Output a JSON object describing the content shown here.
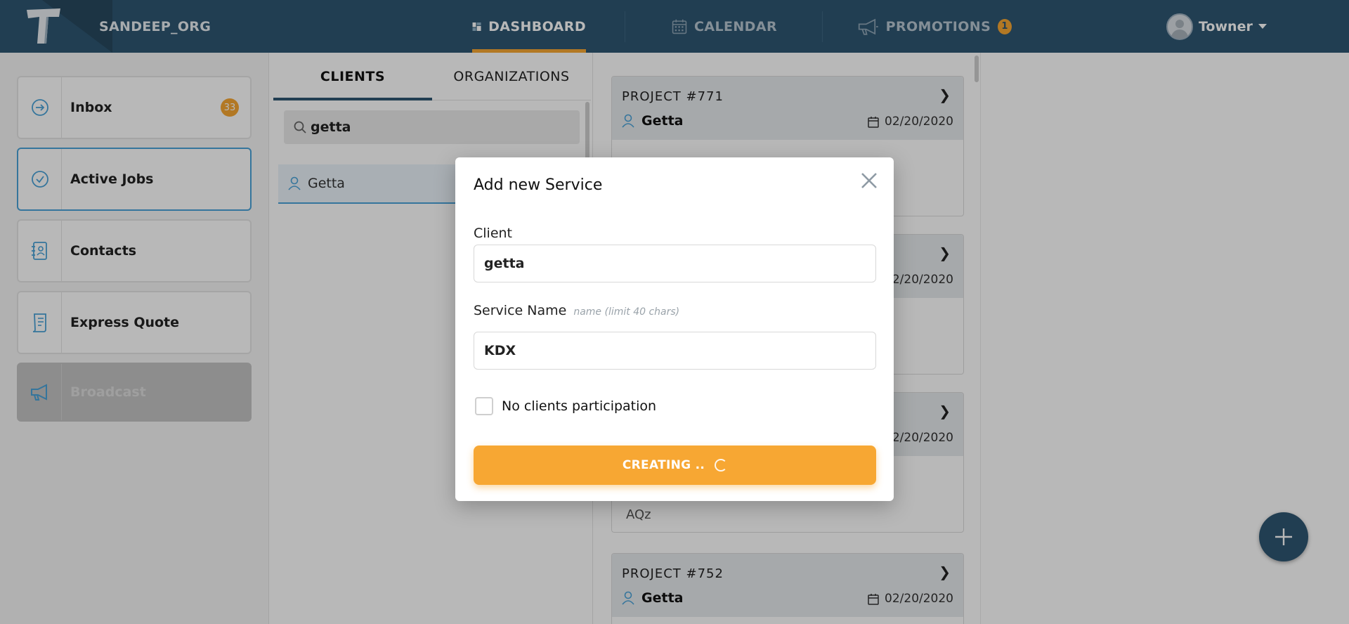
{
  "org": {
    "name": "SANDEEP_ORG"
  },
  "nav": {
    "dashboard": "DASHBOARD",
    "calendar": "CALENDAR",
    "promotions": "PROMOTIONS",
    "promotions_badge": "1"
  },
  "user": {
    "name": "Towner"
  },
  "sidebar": {
    "items": [
      {
        "label": "Inbox",
        "icon": "arrow-circle-icon",
        "badge": "33"
      },
      {
        "label": "Active Jobs",
        "icon": "check-circle-icon"
      },
      {
        "label": "Contacts",
        "icon": "contacts-book-icon"
      },
      {
        "label": "Express Quote",
        "icon": "quote-doc-icon"
      },
      {
        "label": "Broadcast",
        "icon": "megaphone-icon"
      }
    ]
  },
  "clients": {
    "tabs": [
      "CLIENTS",
      "ORGANIZATIONS"
    ],
    "search_value": "getta",
    "list": [
      {
        "name": "Getta"
      }
    ]
  },
  "projects": [
    {
      "title": "PROJECT #771",
      "client": "Getta",
      "date": "02/20/2020",
      "note": ""
    },
    {
      "title": "",
      "client": "",
      "date": "2/20/2020",
      "note": ""
    },
    {
      "title": "",
      "client": "",
      "date": "2/20/2020",
      "note": "AQz"
    },
    {
      "title": "PROJECT #752",
      "client": "Getta",
      "date": "02/20/2020",
      "note": ""
    }
  ],
  "modal": {
    "title": "Add new Service",
    "client_label": "Client",
    "client_value": "getta",
    "service_label": "Service Name",
    "service_hint": "name (limit 40 chars)",
    "service_value": "KDX",
    "checkbox_label": "No clients participation",
    "button_label": "CREATING .."
  },
  "colors": {
    "nav_bg": "#2e5672",
    "accent_orange": "#f7a733",
    "active_border": "#4aa3d8"
  }
}
